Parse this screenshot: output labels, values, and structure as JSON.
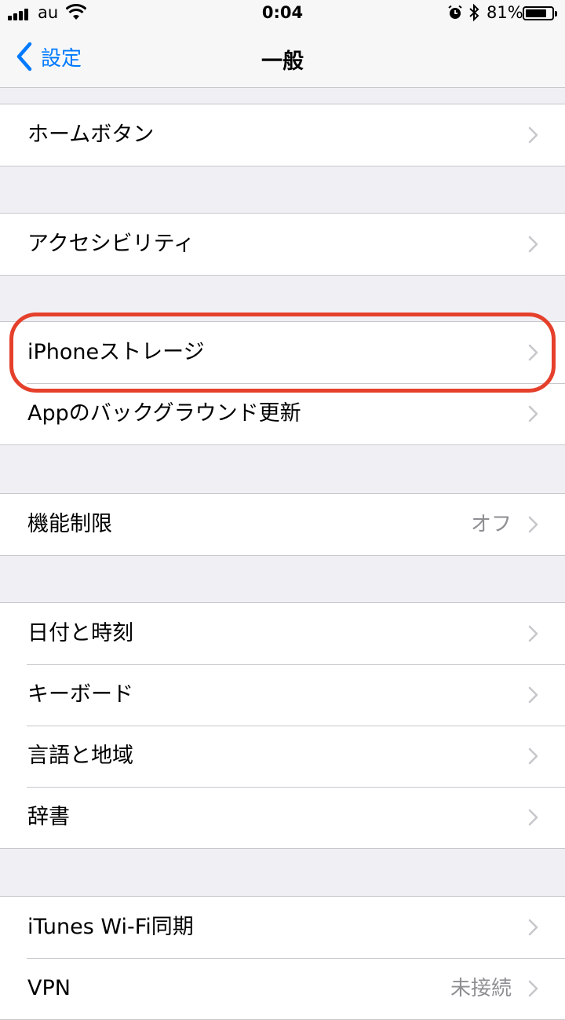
{
  "status_bar": {
    "carrier": "au",
    "time": "0:04",
    "battery_percent": "81%",
    "battery_level": 0.81
  },
  "nav": {
    "back_label": "設定",
    "title": "一般"
  },
  "groups": [
    {
      "rows": [
        {
          "label": "ホームボタン",
          "value": ""
        }
      ]
    },
    {
      "rows": [
        {
          "label": "アクセシビリティ",
          "value": ""
        }
      ]
    },
    {
      "rows": [
        {
          "label": "iPhoneストレージ",
          "value": ""
        },
        {
          "label": "Appのバックグラウンド更新",
          "value": ""
        }
      ]
    },
    {
      "rows": [
        {
          "label": "機能制限",
          "value": "オフ"
        }
      ]
    },
    {
      "rows": [
        {
          "label": "日付と時刻",
          "value": ""
        },
        {
          "label": "キーボード",
          "value": ""
        },
        {
          "label": "言語と地域",
          "value": ""
        },
        {
          "label": "辞書",
          "value": ""
        }
      ]
    },
    {
      "rows": [
        {
          "label": "iTunes Wi-Fi同期",
          "value": ""
        },
        {
          "label": "VPN",
          "value": "未接続"
        }
      ]
    }
  ],
  "colors": {
    "accent": "#007aff",
    "highlight": "#e5402b",
    "background": "#efeff4"
  }
}
